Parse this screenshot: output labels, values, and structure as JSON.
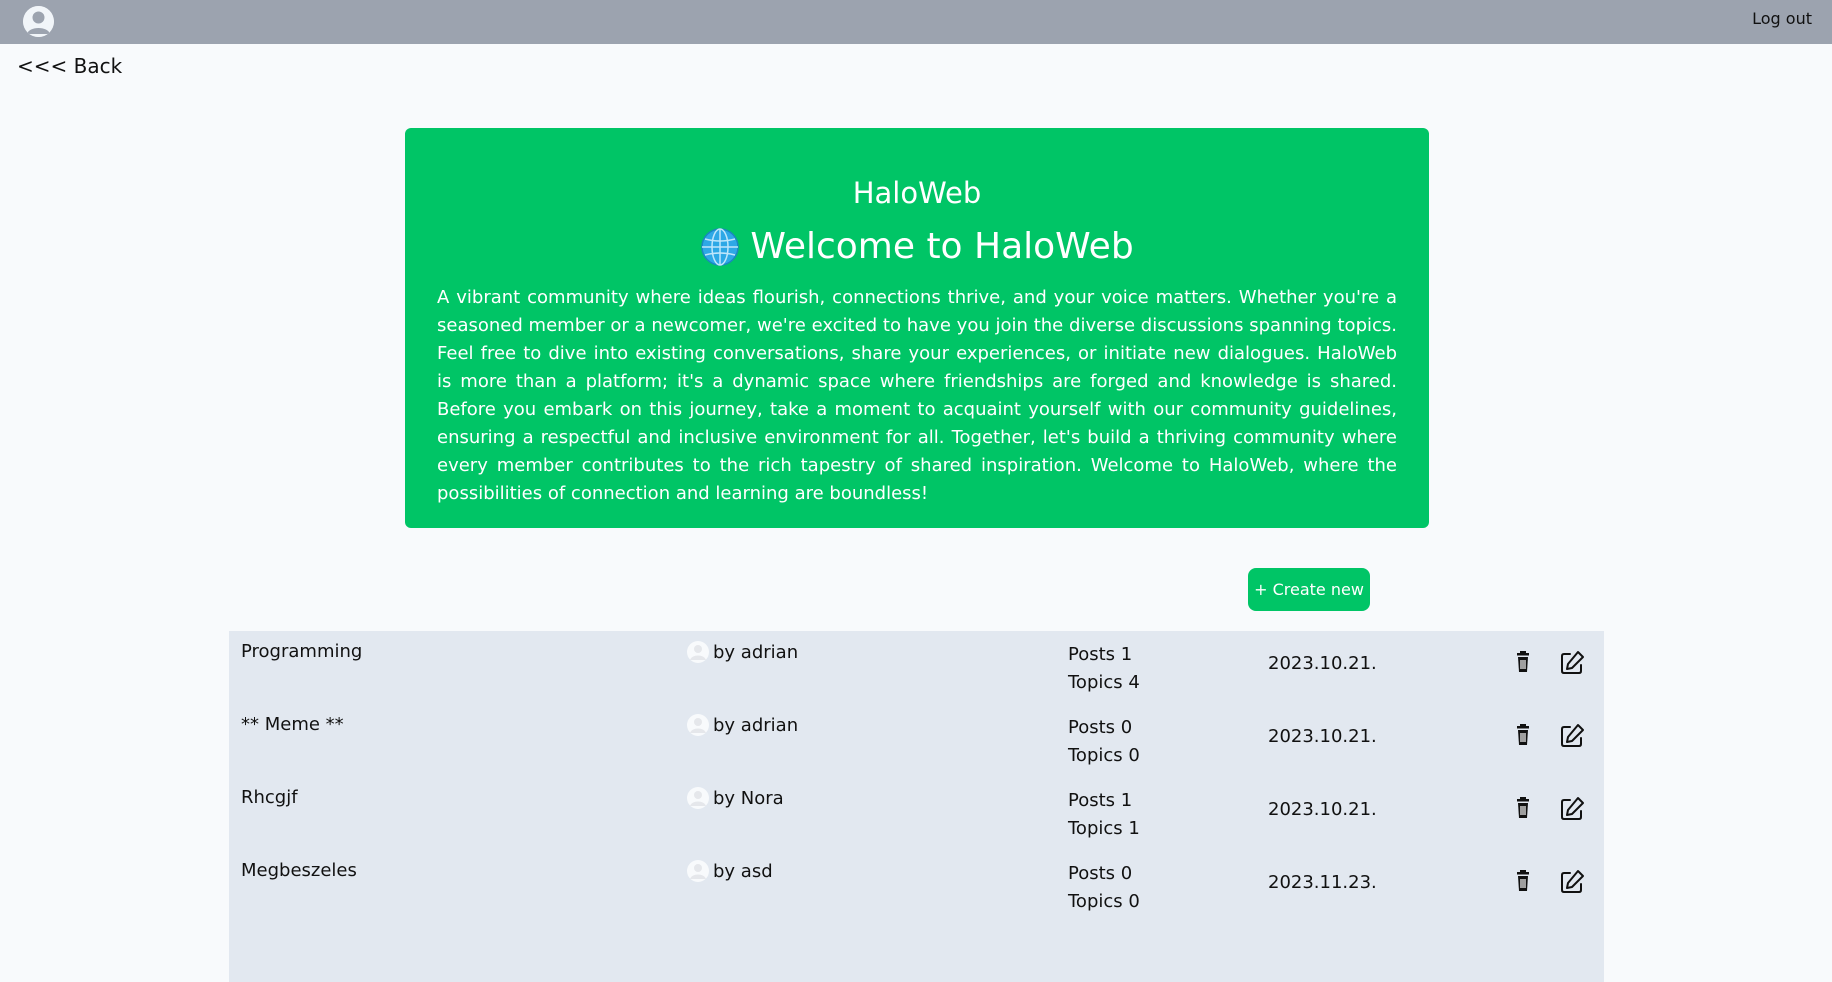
{
  "header": {
    "logout_label": "Log out"
  },
  "nav": {
    "back_label": "<<< Back"
  },
  "hero": {
    "brand": "HaloWeb",
    "title": "Welcome to HaloWeb",
    "text": "A vibrant community where ideas flourish, connections thrive, and your voice matters. Whether you're a seasoned member or a newcomer, we're excited to have you join the diverse discussions spanning topics. Feel free to dive into existing conversations, share your experiences, or initiate new dialogues. HaloWeb is more than a platform; it's a dynamic space where friendships are forged and knowledge is shared. Before you embark on this journey, take a moment to acquaint yourself with our community guidelines, ensuring a respectful and inclusive environment for all. Together, let's build a thriving community where every member contributes to the rich tapestry of shared inspiration. Welcome to HaloWeb, where the possibilities of connection and learning are boundless!",
    "bg_color": "#00c566",
    "icon": "globe-icon"
  },
  "actions": {
    "create_label": "+ Create new"
  },
  "categories": [
    {
      "name": "Programming",
      "author": "by adrian",
      "posts": "Posts 1",
      "topics": "Topics 4",
      "date": "2023.10.21."
    },
    {
      "name": "** Meme **",
      "author": "by adrian",
      "posts": "Posts 0",
      "topics": "Topics 0",
      "date": "2023.10.21."
    },
    {
      "name": "Rhcgjf",
      "author": "by Nora",
      "posts": "Posts 1",
      "topics": "Topics 1",
      "date": "2023.10.21."
    },
    {
      "name": "Megbeszeles",
      "author": "by asd",
      "posts": "Posts 0",
      "topics": "Topics 0",
      "date": "2023.11.23."
    }
  ],
  "icons": {
    "avatar": "user-avatar-icon",
    "author": "user-icon",
    "delete": "trash-icon",
    "edit": "edit-icon"
  }
}
